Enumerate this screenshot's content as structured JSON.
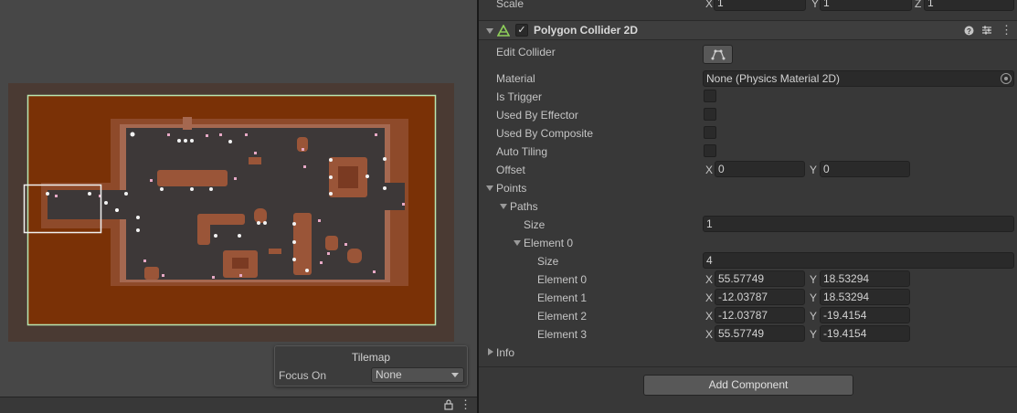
{
  "scene": {
    "tilemap_panel": {
      "title": "Tilemap",
      "focus_label": "Focus On",
      "focus_value": "None"
    }
  },
  "inspector": {
    "scale": {
      "label": "Scale",
      "x": "1",
      "y": "1",
      "z": "1"
    },
    "component": {
      "title": "Polygon Collider 2D",
      "enabled": true
    },
    "edit_collider": {
      "label": "Edit Collider"
    },
    "material": {
      "label": "Material",
      "value": "None (Physics Material 2D)"
    },
    "is_trigger": {
      "label": "Is Trigger"
    },
    "used_by_effector": {
      "label": "Used By Effector"
    },
    "used_by_composite": {
      "label": "Used By Composite"
    },
    "auto_tiling": {
      "label": "Auto Tiling"
    },
    "offset": {
      "label": "Offset",
      "x": "0",
      "y": "0"
    },
    "points": {
      "label": "Points",
      "paths": {
        "label": "Paths",
        "size_label": "Size",
        "size_value": "1",
        "element0": {
          "label": "Element 0",
          "size_label": "Size",
          "size_value": "4",
          "elements": [
            {
              "label": "Element 0",
              "x": "55.57749",
              "y": "18.53294"
            },
            {
              "label": "Element 1",
              "x": "-12.03787",
              "y": "18.53294"
            },
            {
              "label": "Element 2",
              "x": "-12.03787",
              "y": "-19.4154"
            },
            {
              "label": "Element 3",
              "x": "55.57749",
              "y": "-19.4154"
            }
          ]
        }
      }
    },
    "info": {
      "label": "Info"
    },
    "add_component": "Add Component"
  },
  "axis_labels": {
    "x": "X",
    "y": "Y",
    "z": "Z"
  }
}
